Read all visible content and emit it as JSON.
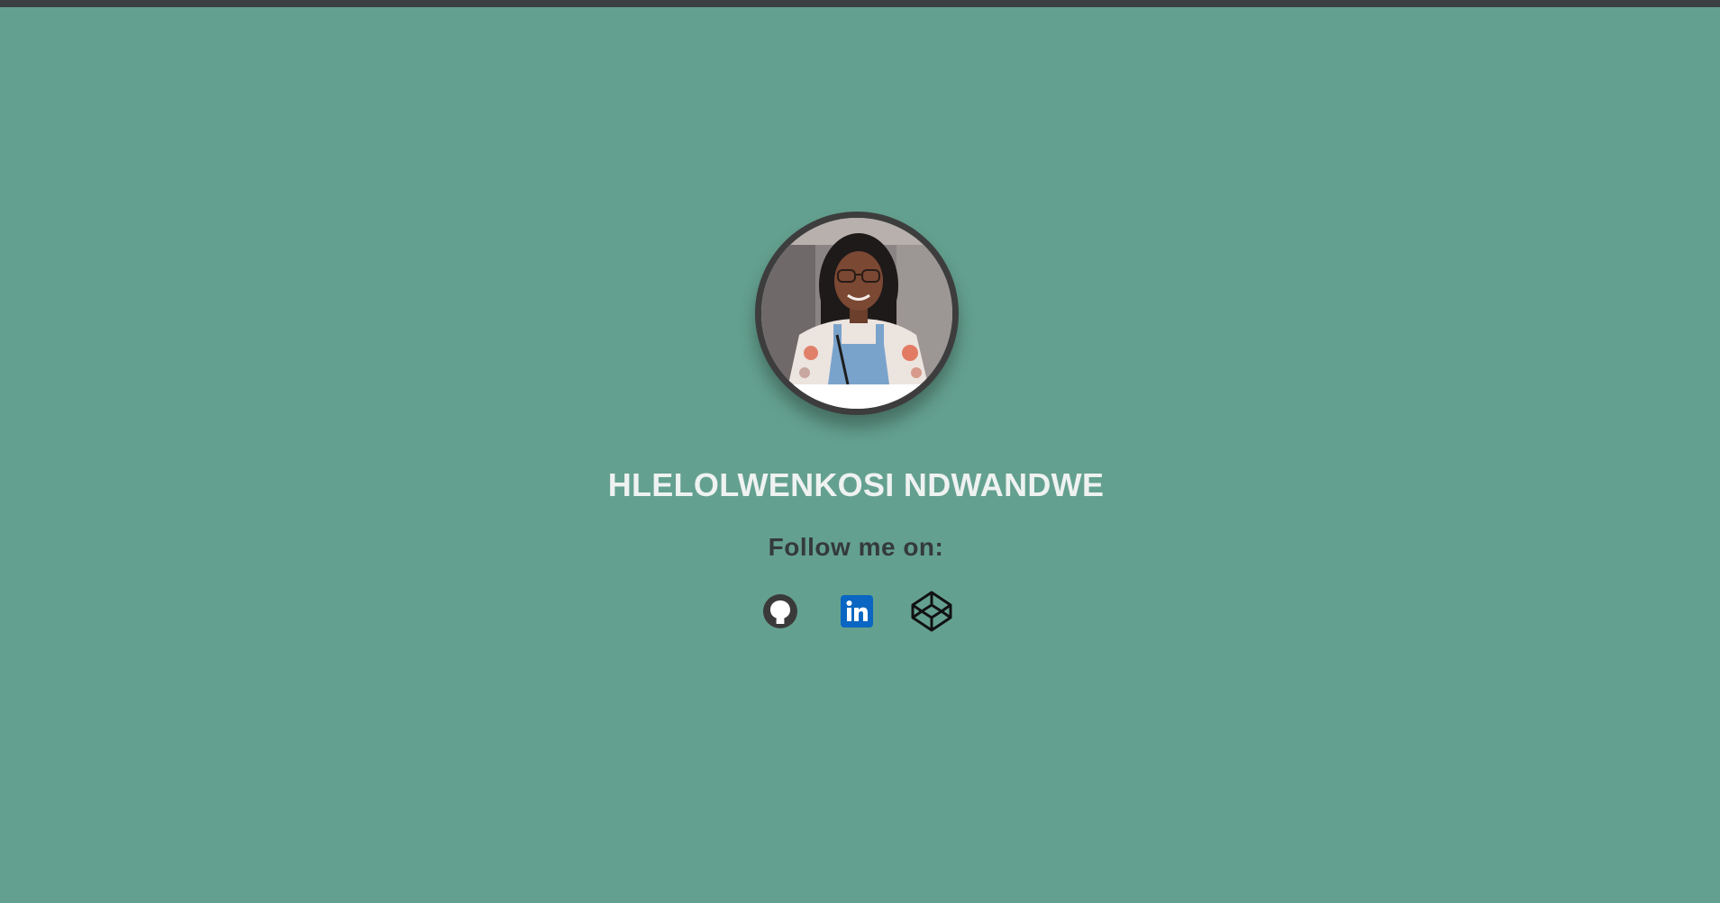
{
  "profile": {
    "name": "HLELOLWENKOSI NDWANDWE",
    "follow_text": "Follow me on:"
  },
  "social_links": [
    {
      "icon": "github-icon"
    },
    {
      "icon": "linkedin-icon"
    },
    {
      "icon": "codepen-icon"
    }
  ],
  "colors": {
    "background": "#64a08f",
    "topbar": "#3b4143",
    "avatar_ring": "#3d3d3d",
    "name_text": "#eef2f0",
    "follow_text": "#343a3c",
    "linkedin_blue": "#0a66c2"
  }
}
